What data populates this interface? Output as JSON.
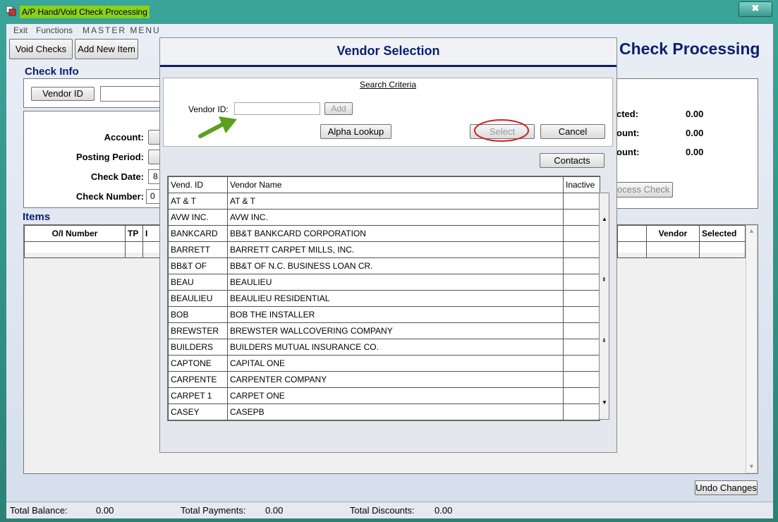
{
  "window": {
    "title": "A/P Hand/Void Check Processing",
    "close_label": "✖"
  },
  "menu": [
    "Exit",
    "Functions",
    "MASTER MENU"
  ],
  "toolbar": {
    "void_checks": "Void Checks",
    "add_new_item": "Add New Item"
  },
  "page_title": "Check Processing",
  "check_info": {
    "section_title": "Check Info",
    "vendor_id_button": "Vendor ID",
    "account_label": "Account:",
    "posting_period_label": "Posting Period:",
    "check_date_label": "Check Date:",
    "check_date_value": "8",
    "check_number_label": "Check Number:",
    "check_number_value": "0",
    "selected_label": "cted:",
    "selected_value": "0.00",
    "amount_label_1": "ount:",
    "amount_value_1": "0.00",
    "amount_label_2": "ount:",
    "amount_value_2": "0.00",
    "process_check_button": "ocess Check"
  },
  "items": {
    "section_title": "Items",
    "columns_left": [
      "O/I Number",
      "TP",
      "I"
    ],
    "columns_right": [
      "Vendor",
      "Selected"
    ]
  },
  "undo_changes": "Undo Changes",
  "footer": {
    "total_balance_label": "Total Balance:",
    "total_balance": "0.00",
    "total_payments_label": "Total Payments:",
    "total_payments": "0.00",
    "total_discounts_label": "Total Discounts:",
    "total_discounts": "0.00"
  },
  "dialog": {
    "title": "Vendor Selection",
    "search_criteria": "Search Criteria",
    "vendor_id_label": "Vendor ID:",
    "vendor_id_value": "",
    "add_button": "Add",
    "alpha_lookup_button": "Alpha Lookup",
    "select_button": "Select",
    "cancel_button": "Cancel",
    "contacts_button": "Contacts",
    "table": {
      "headers": [
        "Vend. ID",
        "Vendor Name",
        "Inactive"
      ],
      "rows": [
        [
          "AT & T",
          "AT & T",
          ""
        ],
        [
          "AVW INC.",
          "AVW INC.",
          ""
        ],
        [
          "BANKCARD",
          "BB&T BANKCARD CORPORATION",
          ""
        ],
        [
          "BARRETT",
          "BARRETT CARPET MILLS, INC.",
          ""
        ],
        [
          "BB&T OF",
          "BB&T OF N.C. BUSINESS LOAN CR.",
          ""
        ],
        [
          "BEAU",
          "BEAULIEU",
          ""
        ],
        [
          "BEAULIEU",
          "BEAULIEU RESIDENTIAL",
          ""
        ],
        [
          "BOB",
          "BOB THE INSTALLER",
          ""
        ],
        [
          "BREWSTER",
          "BREWSTER WALLCOVERING COMPANY",
          ""
        ],
        [
          "BUILDERS",
          "BUILDERS MUTUAL INSURANCE CO.",
          ""
        ],
        [
          "CAPTONE",
          "CAPITAL ONE",
          ""
        ],
        [
          "CARPENTE",
          "CARPENTER COMPANY",
          ""
        ],
        [
          "CARPET 1",
          "CARPET ONE",
          ""
        ],
        [
          "CASEY",
          "CASEPB",
          ""
        ]
      ]
    }
  },
  "colors": {
    "accent": "#0b1f6e",
    "highlight": "#8ad11c",
    "annotation_arrow": "#5aa01e",
    "annotation_circle": "#d42020"
  }
}
